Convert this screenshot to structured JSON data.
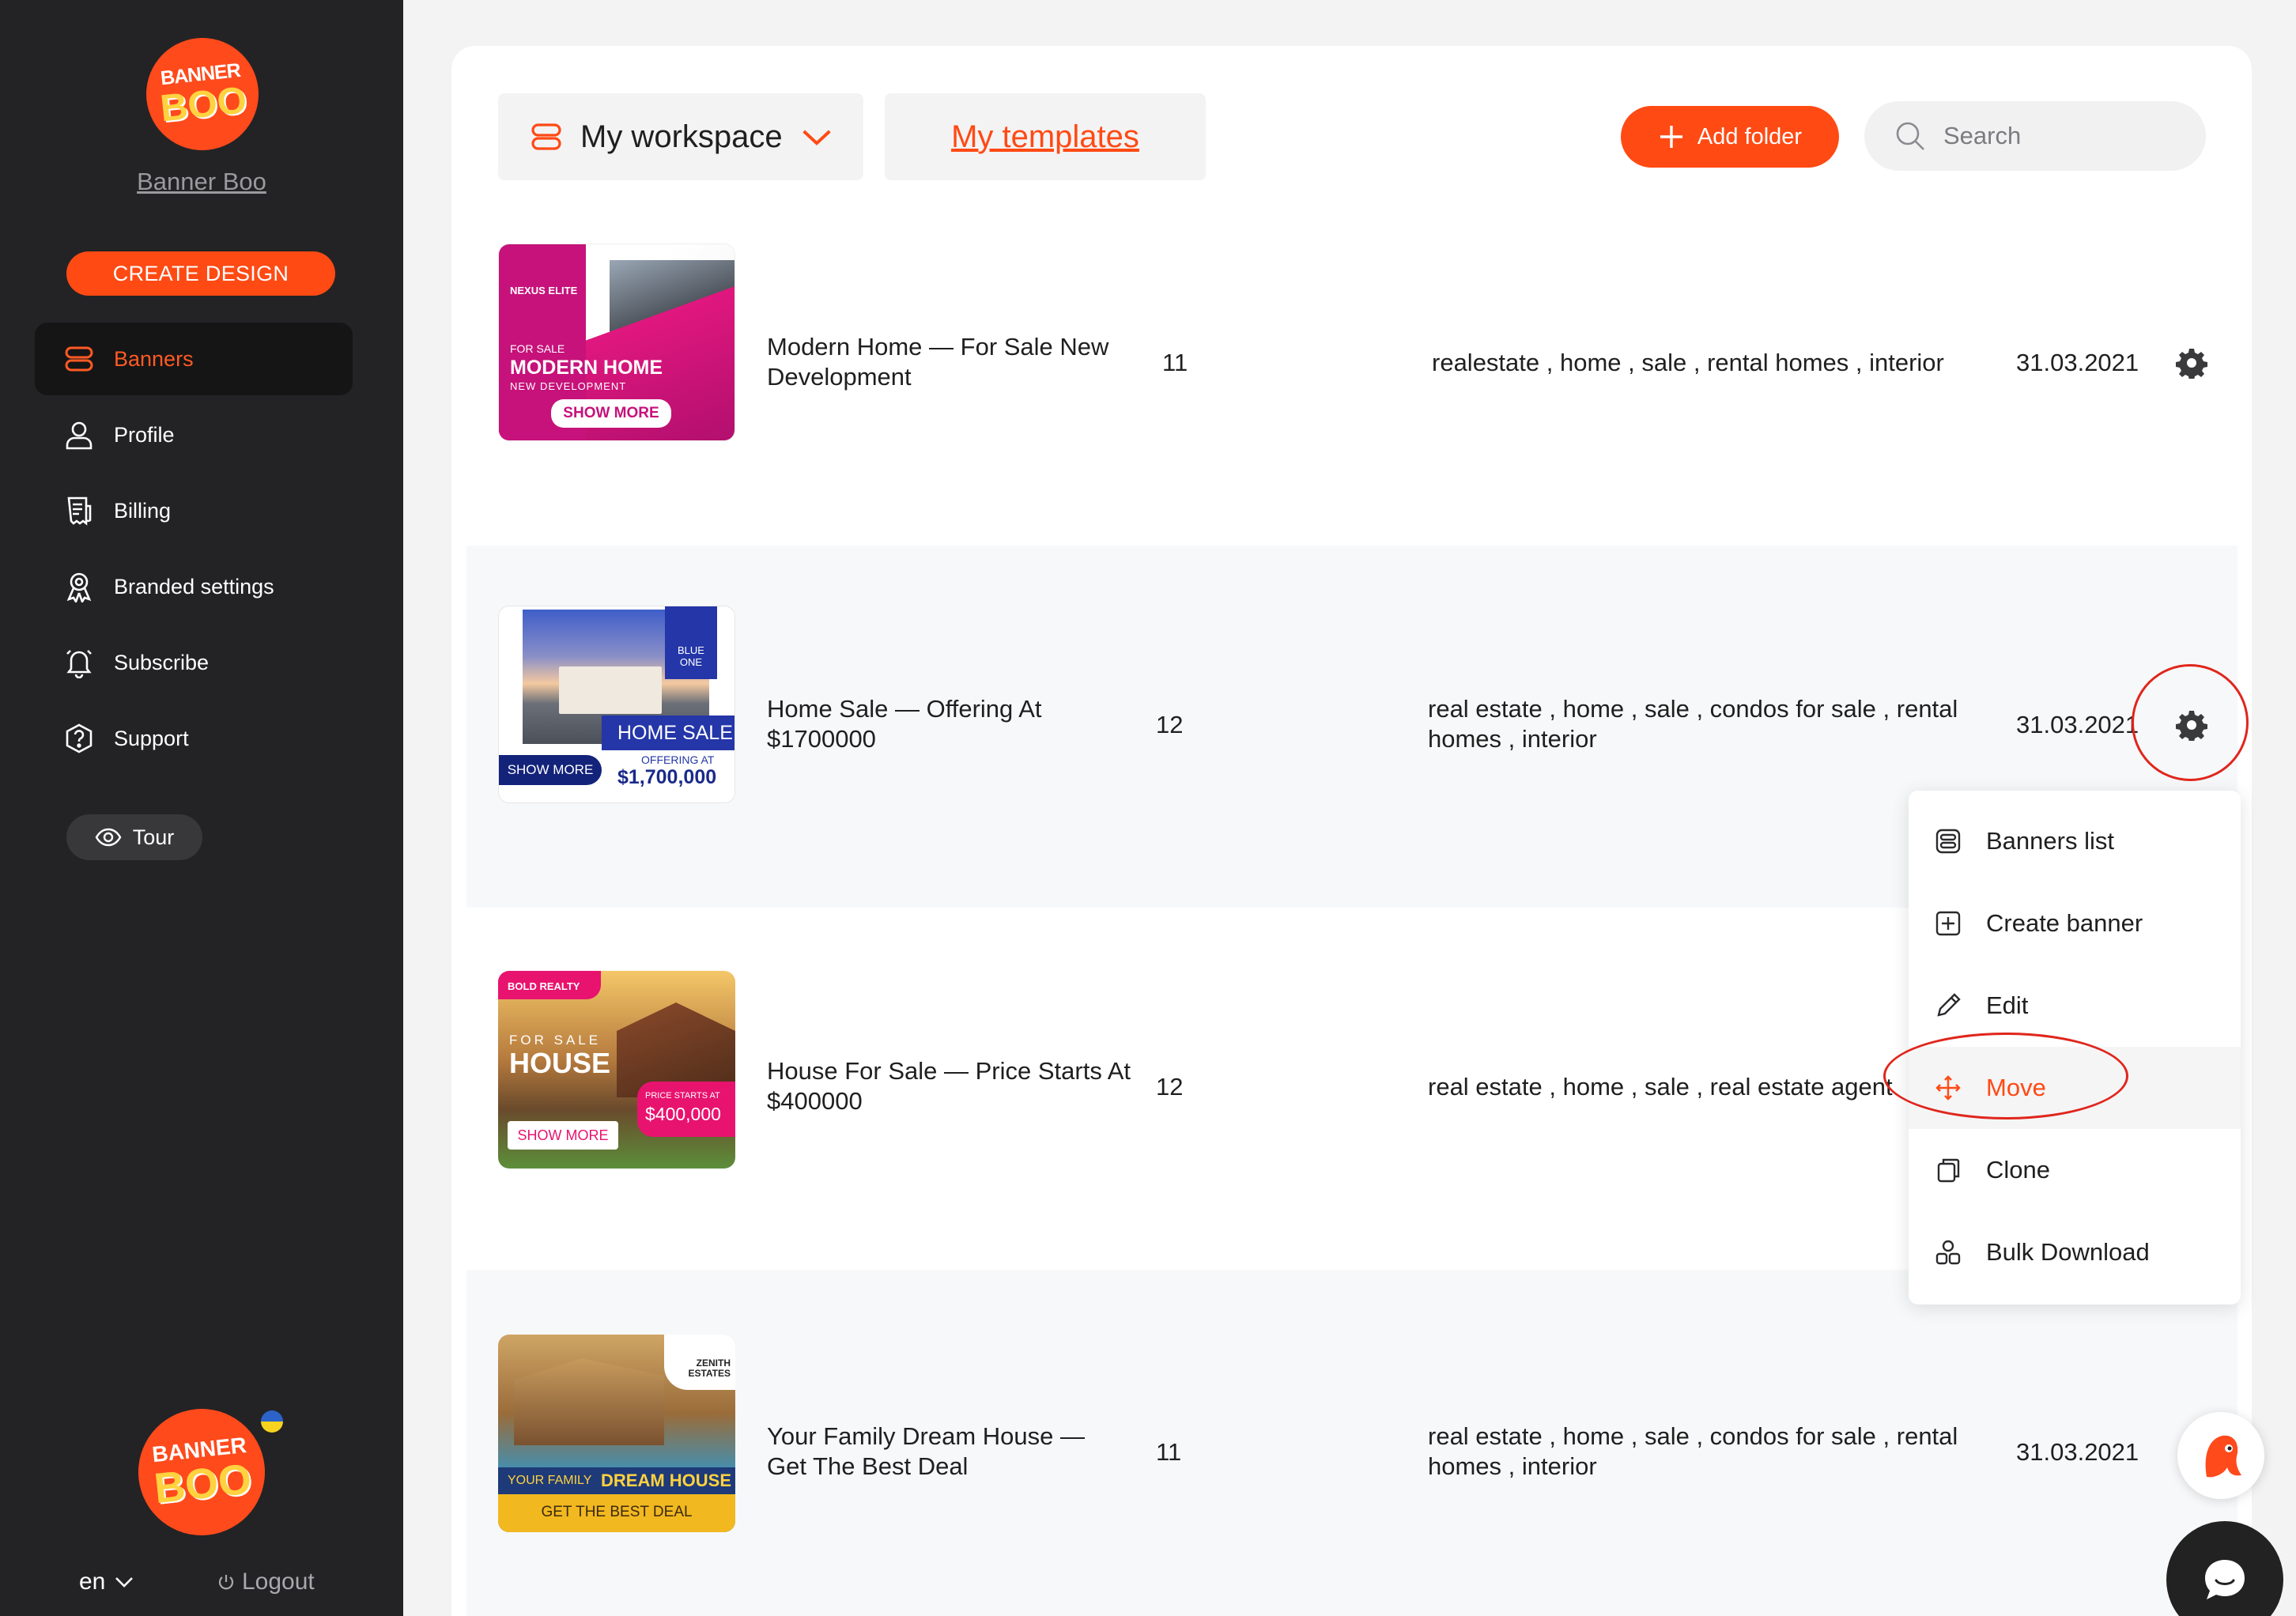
{
  "sidebar": {
    "logo_top": "BANNER",
    "logo_bottom": "BOO",
    "brand_name": "Banner Boo",
    "create_label": "CREATE DESIGN",
    "nav": [
      {
        "label": "Banners",
        "icon": "stack-icon",
        "active": true
      },
      {
        "label": "Profile",
        "icon": "user-icon"
      },
      {
        "label": "Billing",
        "icon": "receipt-icon"
      },
      {
        "label": "Branded settings",
        "icon": "award-icon"
      },
      {
        "label": "Subscribe",
        "icon": "bell-icon"
      },
      {
        "label": "Support",
        "icon": "help-icon"
      }
    ],
    "tour_label": "Tour",
    "language": "en",
    "logout_label": "Logout"
  },
  "toolbar": {
    "workspace_label": "My workspace",
    "templates_label": "My templates",
    "add_folder_label": "Add folder",
    "search_placeholder": "Search"
  },
  "rows": [
    {
      "title": "Modern Home — For Sale New Development",
      "count": "11",
      "tags": "realestate , home , sale , rental homes , interior",
      "date": "31.03.2021",
      "thumb": {
        "brand": "NEXUS ELITE",
        "kicker": "FOR SALE",
        "headline": "MODERN HOME",
        "sub": "NEW DEVELOPMENT",
        "cta": "SHOW MORE"
      }
    },
    {
      "title": "Home Sale — Offering At $1700000",
      "count": "12",
      "tags": "real estate , home , sale , condos for sale , rental homes , interior",
      "date": "31.03.2021",
      "thumb": {
        "brand": "BLUE ONE",
        "headline": "HOME SALE",
        "sub": "OFFERING AT",
        "price": "$1,700,000",
        "cta": "SHOW MORE"
      }
    },
    {
      "title": "House For Sale — Price Starts At $400000",
      "count": "12",
      "tags": "real estate , home , sale , real estate agent",
      "date": "",
      "thumb": {
        "brand": "BOLD REALTY",
        "kicker": "FOR SALE",
        "headline": "HOUSE",
        "sub": "PRICE STARTS AT",
        "price": "$400,000",
        "cta": "SHOW MORE"
      }
    },
    {
      "title": "Your Family Dream House — Get The Best Deal",
      "count": "11",
      "tags": "real estate , home , sale , condos for sale , rental homes , interior",
      "date": "31.03.2021",
      "thumb": {
        "brand": "ZENITH ESTATES",
        "kicker": "YOUR FAMILY",
        "headline": "DREAM HOUSE",
        "cta": "GET THE BEST DEAL"
      }
    }
  ],
  "menu": {
    "items": [
      {
        "label": "Banners list",
        "icon": "list-icon"
      },
      {
        "label": "Create banner",
        "icon": "plus-square-icon"
      },
      {
        "label": "Edit",
        "icon": "pencil-icon"
      },
      {
        "label": "Move",
        "icon": "move-icon",
        "highlighted": true
      },
      {
        "label": "Clone",
        "icon": "copy-icon"
      },
      {
        "label": "Bulk Download",
        "icon": "shapes-icon"
      }
    ]
  },
  "colors": {
    "accent": "#ff4a14",
    "sidebar": "#232325",
    "annotation": "#e0261c"
  }
}
